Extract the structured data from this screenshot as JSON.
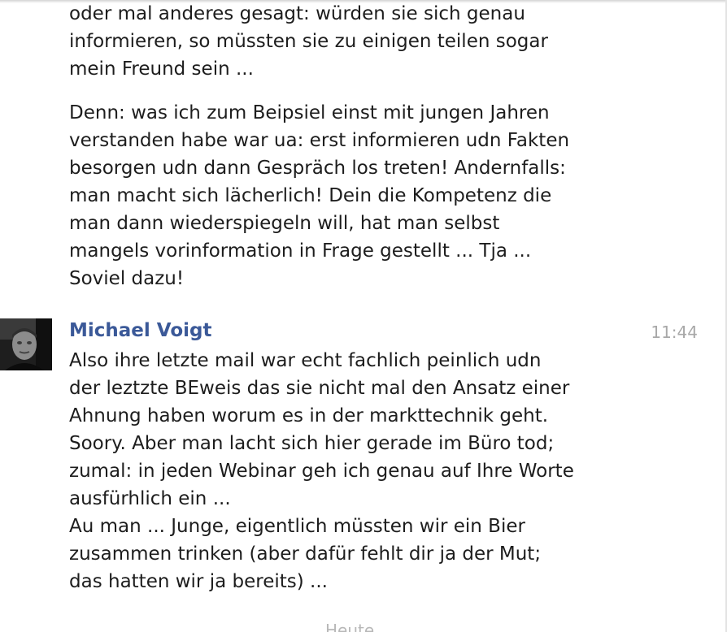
{
  "messages": [
    {
      "lines": [
        "oder mal anderes gesagt: würden sie sich genau",
        "informieren, so müssten sie zu einigen teilen sogar",
        "mein Freund sein ..."
      ]
    },
    {
      "lines": [
        "Denn: was ich zum Beipsiel einst mit jungen Jahren",
        "verstanden habe war ua: erst informieren udn Fakten",
        "besorgen udn dann Gespräch los treten! Andernfalls:",
        "man macht sich lächerlich! Dein die Kompetenz die",
        "man dann wiederspiegeln will, hat man selbst",
        "mangels vorinformation in Frage gestellt ... Tja ...",
        "Soviel dazu!"
      ]
    }
  ],
  "reply": {
    "sender": "Michael Voigt",
    "time": "11:44",
    "lines": [
      "Also ihre letzte mail war echt fachlich peinlich udn",
      "der leztzte BEweis das sie nicht mal den Ansatz einer",
      "Ahnung haben worum es in der markttechnik geht.",
      "Soory. Aber man lacht sich hier gerade im Büro tod;",
      "zumal: in jeden Webinar geh ich genau auf Ihre Worte",
      "ausfürhlich ein ...",
      "Au man ... Junge, eigentlich müssten wir ein Bier",
      "zusammen trinken (aber dafür fehlt dir ja der Mut;",
      "das hatten wir ja bereits)  ..."
    ]
  },
  "day_divider": "Heute"
}
